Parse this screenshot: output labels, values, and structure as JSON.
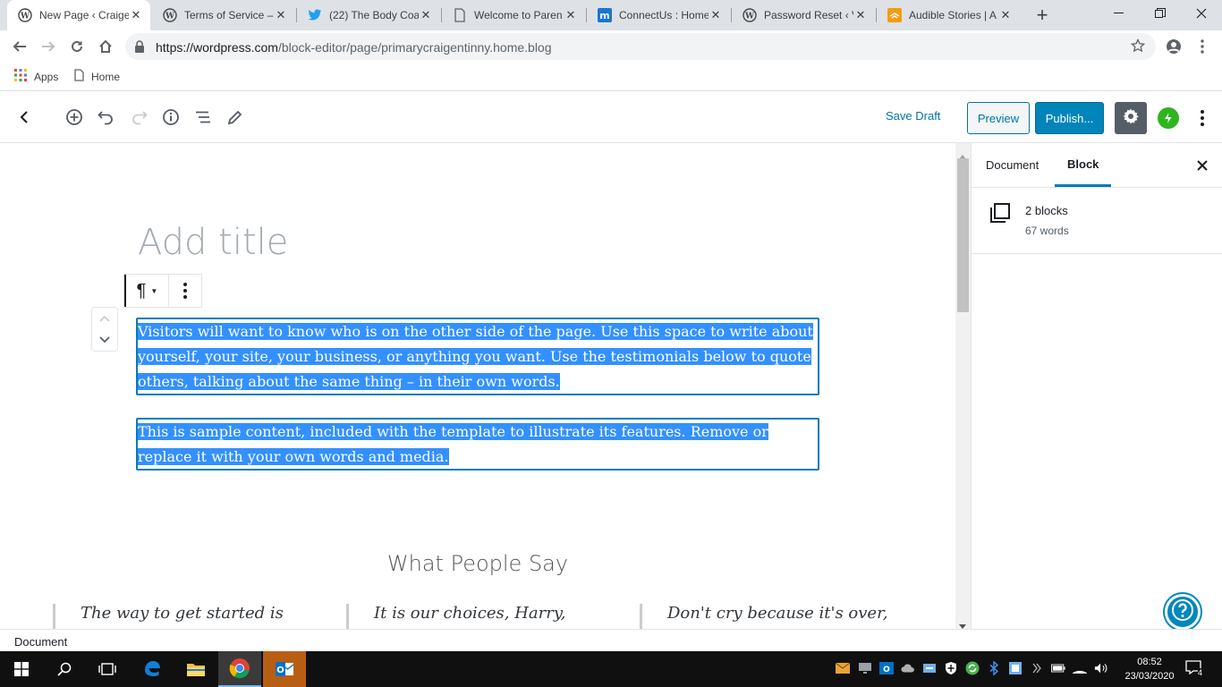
{
  "browser": {
    "tabs": [
      {
        "title": "New Page ‹ Craige",
        "icon": "wordpress-icon",
        "active": true
      },
      {
        "title": "Terms of Service –",
        "icon": "wordpress-icon",
        "active": false
      },
      {
        "title": "(22) The Body Coa",
        "icon": "twitter-icon",
        "active": false
      },
      {
        "title": "Welcome to Paren",
        "icon": "page-icon",
        "active": false
      },
      {
        "title": "ConnectUs : Home",
        "icon": "connectus-icon",
        "active": false
      },
      {
        "title": "Password Reset ‹ V",
        "icon": "wordpress-icon",
        "active": false
      },
      {
        "title": "Audible Stories | A",
        "icon": "audible-icon",
        "active": false
      }
    ],
    "url_host": "https://wordpress.com",
    "url_path": "/block-editor/page/primarycraigentinny.home.blog",
    "bookmarks": [
      {
        "label": "Apps",
        "icon": "apps-grid-icon"
      },
      {
        "label": "Home",
        "icon": "page-icon"
      }
    ]
  },
  "editor": {
    "save_draft": "Save Draft",
    "preview": "Preview",
    "publish": "Publish...",
    "title_placeholder": "Add title",
    "paragraph_symbol": "¶",
    "paragraphs": [
      "Visitors will want to know who is on the other side of the page. Use this space to write about yourself, your site, your business, or anything you want. Use the testimonials below to quote others, talking about the same thing – in their own words.",
      "This is sample content, included with the template to illustrate its features. Remove or replace it with your own words and media."
    ],
    "section_heading": "What People Say",
    "quotes": [
      "The way to get started is",
      "It is our choices, Harry,",
      "Don't cry because it's over,"
    ]
  },
  "sidebar": {
    "tabs": [
      "Document",
      "Block"
    ],
    "active_tab": "Block",
    "block_count": "2 blocks",
    "word_count": "67 words"
  },
  "footer": {
    "breadcrumb": "Document"
  },
  "taskbar": {
    "time": "08:52",
    "date": "23/03/2020",
    "notifications": "4"
  },
  "colors": {
    "accent": "#0073aa",
    "publish": "#0085ba",
    "selection": "#3390ff",
    "block_border": "#007cba",
    "jetpack": "#2fb41f"
  }
}
